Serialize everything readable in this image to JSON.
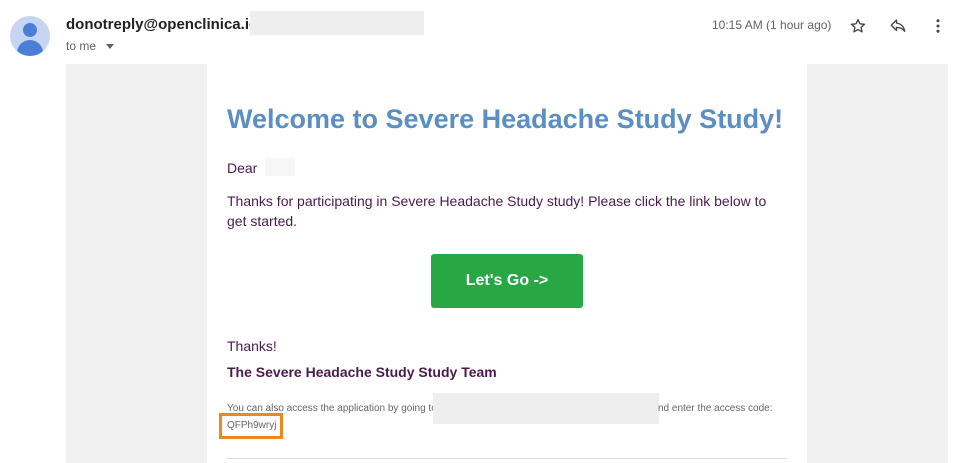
{
  "header": {
    "sender": "donotreply@openclinica.io",
    "recipient": "to me",
    "timestamp": "10:15 AM (1 hour ago)",
    "icons": [
      "avatar-icon",
      "star-icon",
      "reply-icon",
      "more-vert-icon"
    ]
  },
  "email": {
    "title": "Welcome to Severe Headache Study Study!",
    "greeting": "Dear",
    "body": "Thanks for participating in Severe Headache Study study! Please click the link below to get started.",
    "button_label": "Let's Go ->",
    "thanks": "Thanks!",
    "signature": "The Severe Headache Study Study Team",
    "access_text_before": "You can also access the application by going to",
    "access_text_after": "nd enter the access code:",
    "access_code": "QFPh9wryj"
  },
  "colors": {
    "title": "#5b8ec1",
    "body_text": "#4a1a4f",
    "button": "#28a745",
    "highlight_box": "#f0871b",
    "band": "#f0f0f0"
  }
}
